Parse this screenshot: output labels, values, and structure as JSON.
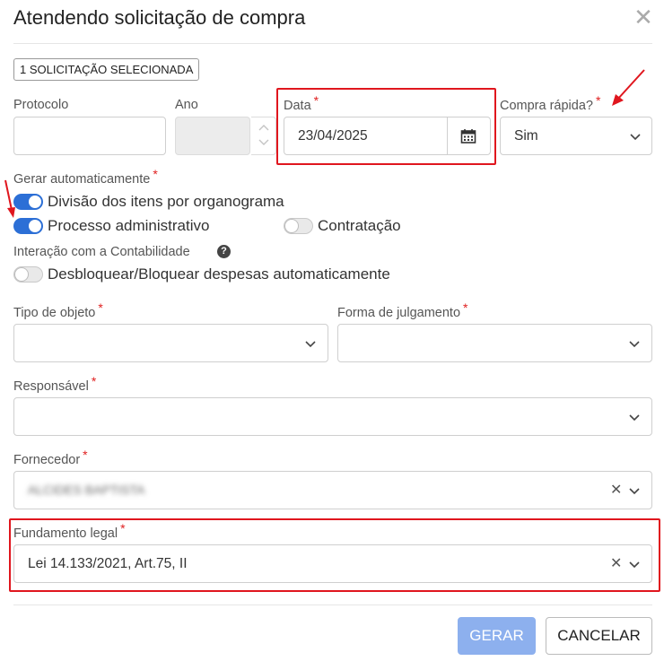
{
  "dialog": {
    "title": "Atendendo solicitação de compra"
  },
  "badge": "1 SOLICITAÇÃO SELECIONADA",
  "fields": {
    "protocolo": {
      "label": "Protocolo",
      "value": ""
    },
    "ano": {
      "label": "Ano",
      "value": ""
    },
    "data": {
      "label": "Data",
      "value": "23/04/2025"
    },
    "compra_rapida": {
      "label": "Compra rápida?",
      "value": "Sim"
    },
    "tipo_objeto": {
      "label": "Tipo de objeto",
      "value": ""
    },
    "forma_julgamento": {
      "label": "Forma de julgamento",
      "value": ""
    },
    "responsavel": {
      "label": "Responsável",
      "value": ""
    },
    "fornecedor": {
      "label": "Fornecedor",
      "value": "ALCIDES BAPTISTA"
    },
    "fundamento_legal": {
      "label": "Fundamento legal",
      "value": "Lei 14.133/2021, Art.75, II"
    }
  },
  "required_mark": "*",
  "gerar": {
    "label": "Gerar automaticamente",
    "toggles": [
      {
        "label": "Divisão dos itens por organograma",
        "on": true
      },
      {
        "label": "Processo administrativo",
        "on": true
      },
      {
        "label": "Contratação",
        "on": false
      }
    ]
  },
  "contabilidade": {
    "label": "Interação com a Contabilidade",
    "toggle": {
      "label": "Desbloquear/Bloquear despesas automaticamente",
      "on": false
    }
  },
  "buttons": {
    "gerar": "GERAR",
    "cancelar": "CANCELAR"
  },
  "colors": {
    "accent": "#2c6fd6",
    "required": "#e02020",
    "highlight": "#e0161e",
    "disabled_button": "#8db0ee"
  }
}
